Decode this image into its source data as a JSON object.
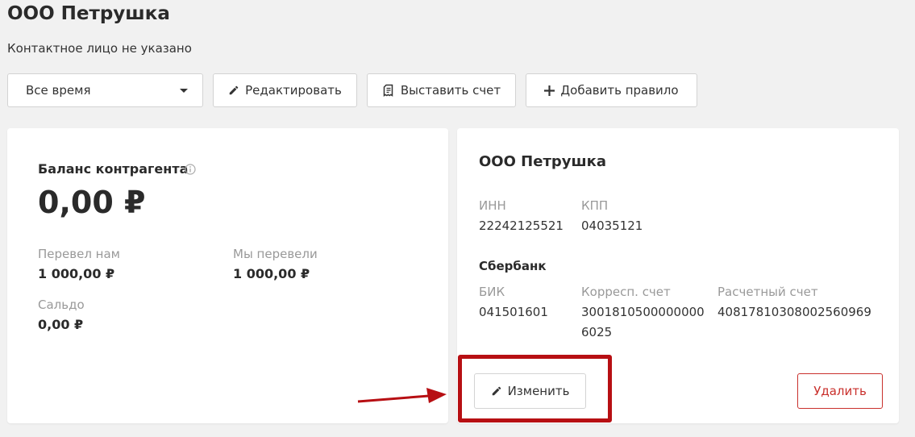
{
  "header": {
    "title": "ООО Петрушка",
    "subtitle": "Контактное лицо не указано"
  },
  "toolbar": {
    "period_select": {
      "selected": "Все время"
    },
    "edit_label": "Редактировать",
    "invoice_label": "Выставить счет",
    "add_rule_label": "Добавить правило"
  },
  "balance": {
    "title": "Баланс контрагента",
    "amount": "0,00 ₽",
    "received_label": "Перевел нам",
    "received_value": "1 000,00 ₽",
    "sent_label": "Мы перевели",
    "sent_value": "1 000,00 ₽",
    "saldo_label": "Сальдо",
    "saldo_value": "0,00 ₽"
  },
  "requisites": {
    "company": "ООО Петрушка",
    "inn_label": "ИНН",
    "inn_value": "22242125521",
    "kpp_label": "КПП",
    "kpp_value": "04035121",
    "bank_name": "Сбербанк",
    "bik_label": "БИК",
    "bik_value": "041501601",
    "corr_label": "Корресп. счет",
    "corr_value_line1": "3001810500000000",
    "corr_value_line2": "6025",
    "account_label": "Расчетный счет",
    "account_value": "40817810308002560969",
    "change_label": "Изменить",
    "delete_label": "Удалить"
  },
  "annotation": {
    "color": "#b70f13"
  }
}
